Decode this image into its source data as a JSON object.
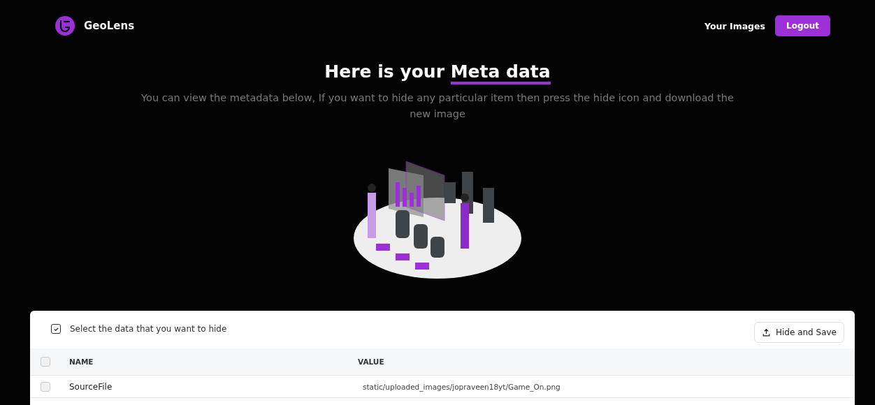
{
  "brand": {
    "name": "GeoLens"
  },
  "nav": {
    "links": [
      "Your Images"
    ],
    "button": "Logout"
  },
  "hero": {
    "title_plain": "Here is your ",
    "title_highlight": "Meta data",
    "subtitle": "You can view the metadata below, If you want to hide any particular item then press the hide icon and download the new image"
  },
  "panel": {
    "select_all": {
      "label": "Select the data that you want to hide",
      "checked": true
    },
    "action_button": "Hide and Save",
    "columns": [
      {
        "label": "NAME",
        "checked": false
      },
      {
        "label": "VALUE"
      }
    ],
    "rows": [
      {
        "name": "SourceFile",
        "value": "static/uploaded_images/jopraveen18yt/Game_On.png",
        "checked": false
      }
    ]
  }
}
